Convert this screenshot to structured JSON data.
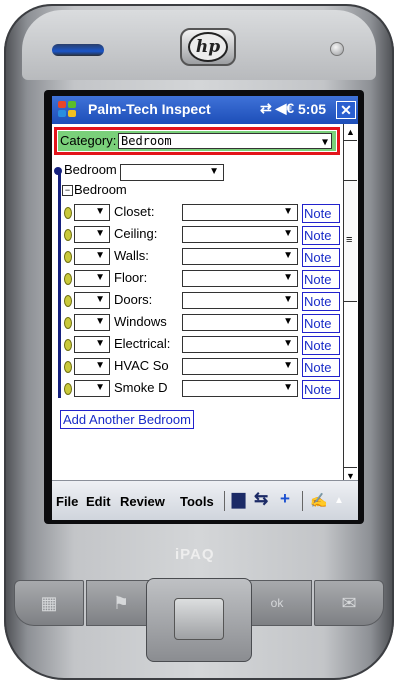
{
  "titlebar": {
    "app_title": "Palm-Tech Inspect",
    "status_icons": "⇄ ◀€",
    "clock": "5:05",
    "close_label": "✕"
  },
  "category": {
    "label": "Category:",
    "value": "Bedroom"
  },
  "section": {
    "group_label": "Bedroom",
    "expanded_label": "Bedroom",
    "expand_symbol": "−"
  },
  "rows": [
    {
      "label": "Closet:",
      "note": "Note"
    },
    {
      "label": "Ceiling:",
      "note": "Note"
    },
    {
      "label": "Walls:",
      "note": "Note"
    },
    {
      "label": "Floor:",
      "note": "Note"
    },
    {
      "label": "Doors:",
      "note": "Note"
    },
    {
      "label": "Windows",
      "note": "Note"
    },
    {
      "label": "Electrical:",
      "note": "Note"
    },
    {
      "label": "HVAC So",
      "note": "Note"
    },
    {
      "label": "Smoke D",
      "note": "Note"
    }
  ],
  "add_button": "Add Another Bedroom",
  "menubar": {
    "file": "File",
    "edit": "Edit",
    "review": "Review",
    "tools": "Tools"
  },
  "device": {
    "brand": "hp",
    "model": "iPAQ"
  },
  "colors": {
    "titlebar": "#2a5fd0",
    "category_bg": "#7ad07a",
    "highlight_outline": "#e3141b",
    "link_blue": "#1a2cc8"
  },
  "icons": [
    "windows-flag-icon",
    "connectivity-icon",
    "volume-icon",
    "close-icon",
    "save-icon",
    "sync-icon",
    "add-item-icon",
    "keyboard-icon",
    "dropdown-arrow-icon",
    "scroll-up-icon",
    "scroll-down-icon"
  ]
}
